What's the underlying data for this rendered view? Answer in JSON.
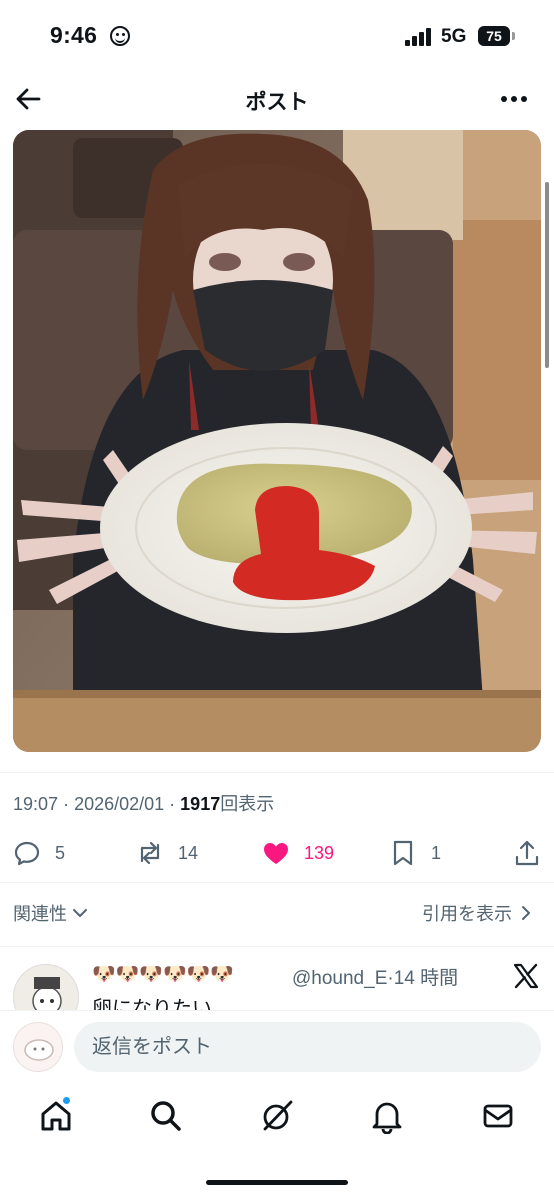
{
  "status": {
    "time": "9:46",
    "network": "5G",
    "battery": "75"
  },
  "header": {
    "title": "ポスト"
  },
  "post": {
    "time": "19:07",
    "date": "2026/02/01",
    "views": "1917",
    "views_label": "回表示",
    "separator": "·"
  },
  "actions": {
    "replies": "5",
    "reposts": "14",
    "likes": "139",
    "bookmarks": "1"
  },
  "filters": {
    "sort_label": "関連性",
    "quotes_label": "引用を表示"
  },
  "reply": {
    "name": "🐶🐶🐶🐶🐶🐶",
    "handle": "@hound_E",
    "time": "14 時間",
    "separator": "·",
    "text": "卵になりたい"
  },
  "composer": {
    "placeholder": "返信をポスト"
  },
  "colors": {
    "like": "#f91880",
    "accent": "#1d9bf0",
    "muted": "#536471"
  },
  "icons": [
    "back-arrow-icon",
    "more-icon",
    "reply-icon",
    "repost-icon",
    "heart-icon",
    "bookmark-icon",
    "share-icon",
    "x-logo-icon",
    "home-icon",
    "search-icon",
    "grok-icon",
    "bell-icon",
    "mail-icon"
  ]
}
